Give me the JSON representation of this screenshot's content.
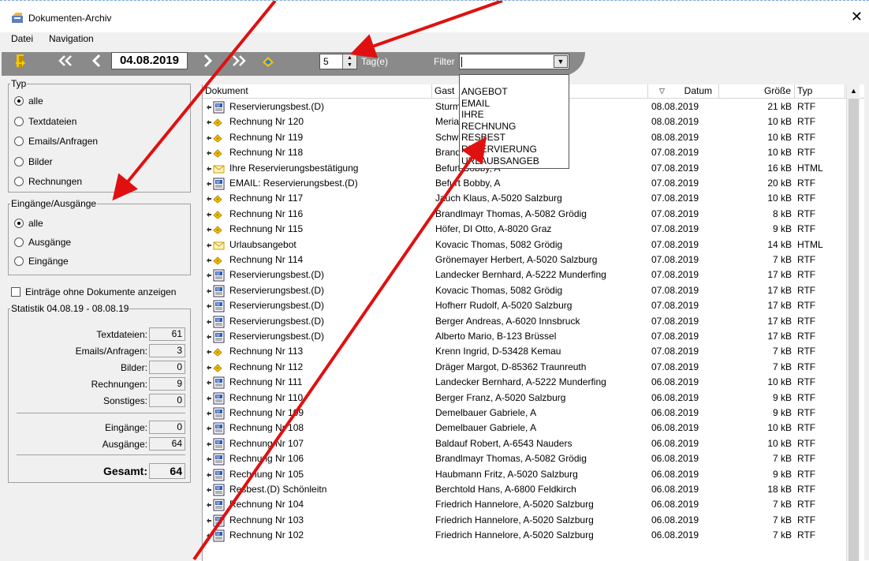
{
  "window": {
    "title": "Dokumenten-Archiv",
    "close_glyph": "✕"
  },
  "menu": {
    "file": "Datei",
    "navigation": "Navigation"
  },
  "toolbar": {
    "date": "04.08.2019",
    "days_value": "5",
    "days_label": "Tag(e)",
    "filter_label": "Filter",
    "filter_value": ""
  },
  "filter_options": [
    "ANGEBOT",
    "EMAIL",
    "IHRE",
    "RECHNUNG",
    "RESBEST",
    "RESERVIERUNG",
    "URLAUBSANGEB"
  ],
  "typ": {
    "legend": "Typ",
    "options": [
      "alle",
      "Textdateien",
      "Emails/Anfragen",
      "Bilder",
      "Rechnungen"
    ],
    "selected": 0
  },
  "direction": {
    "legend": "Eingänge/Ausgänge",
    "options": [
      "alle",
      "Ausgänge",
      "Eingänge"
    ],
    "selected": 0
  },
  "show_empty_label": "Einträge ohne Dokumente anzeigen",
  "stats": {
    "legend": "Statistik 04.08.19 - 08.08.19",
    "textfiles_label": "Textdateien:",
    "textfiles": "61",
    "emails_label": "Emails/Anfragen:",
    "emails": "3",
    "images_label": "Bilder:",
    "images": "0",
    "invoices_label": "Rechnungen:",
    "invoices": "9",
    "other_label": "Sonstiges:",
    "other": "0",
    "incoming_label": "Eingänge:",
    "incoming": "0",
    "outgoing_label": "Ausgänge:",
    "outgoing": "64",
    "total_label": "Gesamt:",
    "total": "64"
  },
  "columns": {
    "doc": "Dokument",
    "guest": "Gast",
    "date": "Datum",
    "size": "Größe",
    "type": "Typ"
  },
  "rows": [
    {
      "icon": "word",
      "doc": "Reservierungsbest.(D)",
      "guest": "Sturm",
      "date": "08.08.2019",
      "size": "21 kB",
      "type": "RTF"
    },
    {
      "icon": "invoice",
      "doc": "Rechnung Nr 120",
      "guest": "Meria",
      "date": "08.08.2019",
      "size": "10 kB",
      "type": "RTF"
    },
    {
      "icon": "invoice",
      "doc": "Rechnung Nr 119",
      "guest": "Schw",
      "date": "08.08.2019",
      "size": "10 kB",
      "type": "RTF"
    },
    {
      "icon": "invoice",
      "doc": "Rechnung Nr 118",
      "guest": "Brand",
      "date": "07.08.2019",
      "size": "10 kB",
      "type": "RTF"
    },
    {
      "icon": "mail",
      "doc": "Ihre Reservierungsbestätigung",
      "guest": "Befurt Bobby, A",
      "date": "07.08.2019",
      "size": "16 kB",
      "type": "HTML"
    },
    {
      "icon": "word",
      "doc": "EMAIL: Reservierungsbest.(D)",
      "guest": "Befurt Bobby, A",
      "date": "07.08.2019",
      "size": "20 kB",
      "type": "RTF"
    },
    {
      "icon": "invoice",
      "doc": "Rechnung Nr 117",
      "guest": "Jauch Klaus, A-5020 Salzburg",
      "date": "07.08.2019",
      "size": "10 kB",
      "type": "RTF"
    },
    {
      "icon": "invoice",
      "doc": "Rechnung Nr 116",
      "guest": "Brandlmayr Thomas, A-5082 Grödig",
      "date": "07.08.2019",
      "size": "8 kB",
      "type": "RTF"
    },
    {
      "icon": "invoice",
      "doc": "Rechnung Nr 115",
      "guest": "Höfer, DI Otto, A-8020 Graz",
      "date": "07.08.2019",
      "size": "9 kB",
      "type": "RTF"
    },
    {
      "icon": "mail",
      "doc": "Urlaubsangebot",
      "guest": "Kovacic Thomas, 5082 Grödig",
      "date": "07.08.2019",
      "size": "14 kB",
      "type": "HTML"
    },
    {
      "icon": "invoice",
      "doc": "Rechnung Nr 114",
      "guest": "Grönemayer Herbert, A-5020 Salzburg",
      "date": "07.08.2019",
      "size": "7 kB",
      "type": "RTF"
    },
    {
      "icon": "word",
      "doc": "Reservierungsbest.(D)",
      "guest": "Landecker Bernhard, A-5222 Munderfing",
      "date": "07.08.2019",
      "size": "17 kB",
      "type": "RTF"
    },
    {
      "icon": "word",
      "doc": "Reservierungsbest.(D)",
      "guest": "Kovacic Thomas, 5082 Grödig",
      "date": "07.08.2019",
      "size": "17 kB",
      "type": "RTF"
    },
    {
      "icon": "word",
      "doc": "Reservierungsbest.(D)",
      "guest": "Hofherr Rudolf, A-5020 Salzburg",
      "date": "07.08.2019",
      "size": "17 kB",
      "type": "RTF"
    },
    {
      "icon": "word",
      "doc": "Reservierungsbest.(D)",
      "guest": "Berger Andreas, A-6020 Innsbruck",
      "date": "07.08.2019",
      "size": "17 kB",
      "type": "RTF"
    },
    {
      "icon": "word",
      "doc": "Reservierungsbest.(D)",
      "guest": "Alberto Mario, B-123 Brüssel",
      "date": "07.08.2019",
      "size": "17 kB",
      "type": "RTF"
    },
    {
      "icon": "invoice",
      "doc": "Rechnung Nr 113",
      "guest": "Krenn Ingrid, D-53428 Kemau",
      "date": "07.08.2019",
      "size": "7 kB",
      "type": "RTF"
    },
    {
      "icon": "invoice",
      "doc": "Rechnung Nr 112",
      "guest": "Dräger Margot, D-85362 Traunreuth",
      "date": "07.08.2019",
      "size": "7 kB",
      "type": "RTF"
    },
    {
      "icon": "word",
      "doc": "Rechnung Nr 111",
      "guest": "Landecker Bernhard, A-5222 Munderfing",
      "date": "06.08.2019",
      "size": "10 kB",
      "type": "RTF"
    },
    {
      "icon": "word",
      "doc": "Rechnung Nr 110",
      "guest": "Berger Franz, A-5020 Salzburg",
      "date": "06.08.2019",
      "size": "9 kB",
      "type": "RTF"
    },
    {
      "icon": "word",
      "doc": "Rechnung Nr 109",
      "guest": "Demelbauer Gabriele, A",
      "date": "06.08.2019",
      "size": "9 kB",
      "type": "RTF"
    },
    {
      "icon": "word",
      "doc": "Rechnung Nr 108",
      "guest": "Demelbauer Gabriele, A",
      "date": "06.08.2019",
      "size": "10 kB",
      "type": "RTF"
    },
    {
      "icon": "word",
      "doc": "Rechnung Nr 107",
      "guest": "Baldauf Robert, A-6543 Nauders",
      "date": "06.08.2019",
      "size": "10 kB",
      "type": "RTF"
    },
    {
      "icon": "word",
      "doc": "Rechnung Nr 106",
      "guest": "Brandlmayr Thomas, A-5082 Grödig",
      "date": "06.08.2019",
      "size": "7 kB",
      "type": "RTF"
    },
    {
      "icon": "word",
      "doc": "Rechnung Nr 105",
      "guest": "Haubmann Fritz, A-5020 Salzburg",
      "date": "06.08.2019",
      "size": "9 kB",
      "type": "RTF"
    },
    {
      "icon": "word",
      "doc": "Resbest.(D) Schönleitn",
      "guest": "Berchtold Hans, A-6800 Feldkirch",
      "date": "06.08.2019",
      "size": "18 kB",
      "type": "RTF"
    },
    {
      "icon": "word",
      "doc": "Rechnung Nr 104",
      "guest": "Friedrich Hannelore, A-5020 Salzburg",
      "date": "06.08.2019",
      "size": "7 kB",
      "type": "RTF"
    },
    {
      "icon": "word",
      "doc": "Rechnung Nr 103",
      "guest": "Friedrich Hannelore, A-5020 Salzburg",
      "date": "06.08.2019",
      "size": "7 kB",
      "type": "RTF"
    },
    {
      "icon": "word",
      "doc": "Rechnung Nr 102",
      "guest": "Friedrich Hannelore, A-5020 Salzburg",
      "date": "06.08.2019",
      "size": "7 kB",
      "type": "RTF"
    }
  ],
  "colors": {
    "toolbar": "#8a8a8a",
    "annotation_arrow": "#e01010"
  }
}
